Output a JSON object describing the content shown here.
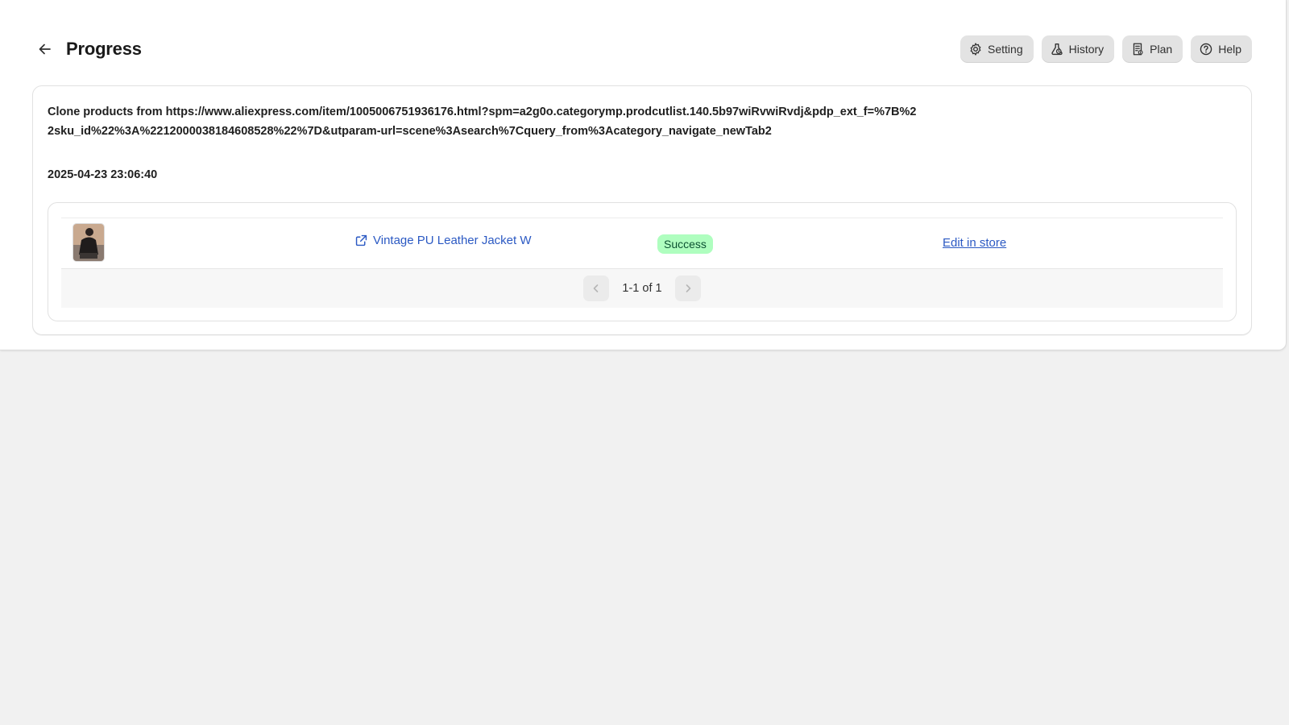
{
  "header": {
    "title": "Progress",
    "actions": [
      {
        "label": "Setting",
        "icon": "gear-icon"
      },
      {
        "label": "History",
        "icon": "history-icon"
      },
      {
        "label": "Plan",
        "icon": "plan-icon"
      },
      {
        "label": "Help",
        "icon": "help-icon"
      }
    ]
  },
  "task": {
    "title": "Clone products from https://www.aliexpress.com/item/1005006751936176.html?spm=a2g0o.categorymp.prodcutlist.140.5b97wiRvwiRvdj&pdp_ext_f=%7B%22sku_id%22%3A%2212000038184608528%22%7D&utparam-url=scene%3Asearch%7Cquery_from%3Acategory_navigate_newTab2",
    "timestamp": "2025-04-23 23:06:40"
  },
  "products": [
    {
      "name": "Vintage PU Leather Jacket W",
      "status": "Success",
      "action": "Edit in store"
    }
  ],
  "pagination": {
    "info": "1-1 of 1"
  },
  "colors": {
    "link": "#2b59c3",
    "success_bg": "#affebf",
    "success_text": "#0c5132",
    "button_bg": "#e3e3e3"
  }
}
